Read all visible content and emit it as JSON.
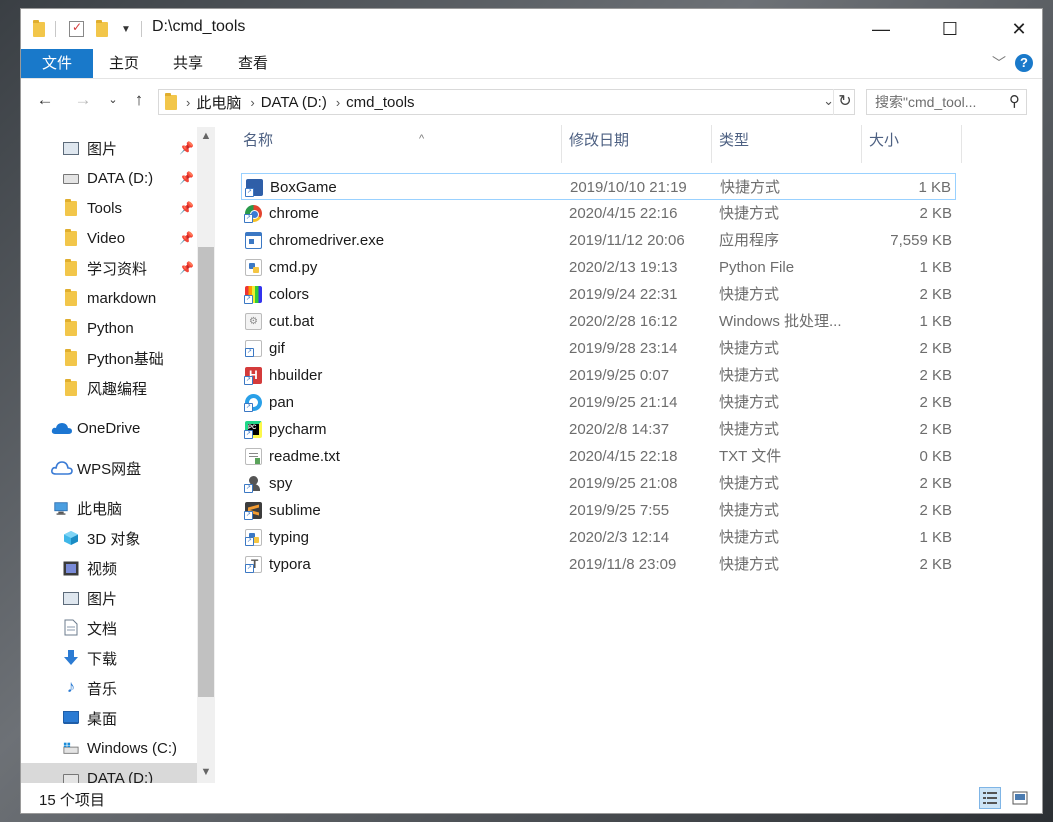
{
  "window": {
    "title": "D:\\cmd_tools",
    "controls": {
      "minimize": "—",
      "maximize": "☐",
      "close": "✕"
    }
  },
  "ribbon": {
    "tabs": [
      {
        "label": "文件"
      },
      {
        "label": "主页"
      },
      {
        "label": "共享"
      },
      {
        "label": "查看"
      }
    ],
    "help": "?"
  },
  "nav": {
    "path": [
      "此电脑",
      "DATA (D:)",
      "cmd_tools"
    ],
    "search_placeholder": "搜索\"cmd_tool..."
  },
  "sidebar": {
    "items": [
      {
        "label": "图片",
        "icon": "pictures-icon",
        "pinned": true
      },
      {
        "label": "DATA (D:)",
        "icon": "drive-icon",
        "pinned": true
      },
      {
        "label": "Tools",
        "icon": "folder-icon",
        "pinned": true
      },
      {
        "label": "Video",
        "icon": "folder-icon",
        "pinned": true
      },
      {
        "label": "学习资料",
        "icon": "folder-icon",
        "pinned": true
      },
      {
        "label": "markdown",
        "icon": "folder-icon",
        "pinned": false
      },
      {
        "label": "Python",
        "icon": "folder-icon",
        "pinned": false
      },
      {
        "label": "Python基础",
        "icon": "folder-icon",
        "pinned": false
      },
      {
        "label": "风趣编程",
        "icon": "folder-icon",
        "pinned": false
      },
      {
        "label": "OneDrive",
        "icon": "cloud-icon",
        "pinned": false
      },
      {
        "label": "WPS网盘",
        "icon": "wps-cloud-icon",
        "pinned": false
      },
      {
        "label": "此电脑",
        "icon": "computer-icon",
        "pinned": false
      },
      {
        "label": "3D 对象",
        "icon": "3d-objects-icon",
        "pinned": false
      },
      {
        "label": "视频",
        "icon": "videos-icon",
        "pinned": false
      },
      {
        "label": "图片",
        "icon": "pictures-icon",
        "pinned": false
      },
      {
        "label": "文档",
        "icon": "documents-icon",
        "pinned": false
      },
      {
        "label": "下载",
        "icon": "download-icon",
        "pinned": false
      },
      {
        "label": "音乐",
        "icon": "music-icon",
        "pinned": false
      },
      {
        "label": "桌面",
        "icon": "desktop-icon",
        "pinned": false
      },
      {
        "label": "Windows (C:)",
        "icon": "windows-drive-icon",
        "pinned": false
      },
      {
        "label": "DATA (D:)",
        "icon": "drive-icon",
        "pinned": false,
        "selected": true
      }
    ]
  },
  "columns": {
    "name": "名称",
    "date": "修改日期",
    "type": "类型",
    "size": "大小"
  },
  "files": [
    {
      "name": "BoxGame",
      "date": "2019/10/10 21:19",
      "type": "快捷方式",
      "size": "1 KB",
      "icon": "boxgame-icon",
      "color": "#2f5fa8",
      "selected": true
    },
    {
      "name": "chrome",
      "date": "2020/4/15 22:16",
      "type": "快捷方式",
      "size": "2 KB",
      "icon": "chrome-icon",
      "color": "#e3432f"
    },
    {
      "name": "chromedriver.exe",
      "date": "2019/11/12 20:06",
      "type": "应用程序",
      "size": "7,559 KB",
      "icon": "exe-icon",
      "color": "#3b78c4"
    },
    {
      "name": "cmd.py",
      "date": "2020/2/13 19:13",
      "type": "Python File",
      "size": "1 KB",
      "icon": "python-file-icon",
      "color": "#f4c542"
    },
    {
      "name": "colors",
      "date": "2019/9/24 22:31",
      "type": "快捷方式",
      "size": "2 KB",
      "icon": "colors-icon",
      "color": "#c23bd4"
    },
    {
      "name": "cut.bat",
      "date": "2020/2/28 16:12",
      "type": "Windows 批处理...",
      "size": "1 KB",
      "icon": "bat-file-icon",
      "color": "#9a9a9a"
    },
    {
      "name": "gif",
      "date": "2019/9/28 23:14",
      "type": "快捷方式",
      "size": "2 KB",
      "icon": "gif-icon",
      "color": "#8a8a8a"
    },
    {
      "name": "hbuilder",
      "date": "2019/9/25 0:07",
      "type": "快捷方式",
      "size": "2 KB",
      "icon": "hbuilder-icon",
      "color": "#d43b3b"
    },
    {
      "name": "pan",
      "date": "2019/9/25 21:14",
      "type": "快捷方式",
      "size": "2 KB",
      "icon": "pan-icon",
      "color": "#2aa0e8"
    },
    {
      "name": "pycharm",
      "date": "2020/2/8 14:37",
      "type": "快捷方式",
      "size": "2 KB",
      "icon": "pycharm-icon",
      "color": "#21d789"
    },
    {
      "name": "readme.txt",
      "date": "2020/4/15 22:18",
      "type": "TXT 文件",
      "size": "0 KB",
      "icon": "txt-file-icon",
      "color": "#5aa35a"
    },
    {
      "name": "spy",
      "date": "2019/9/25 21:08",
      "type": "快捷方式",
      "size": "2 KB",
      "icon": "spy-icon",
      "color": "#555555"
    },
    {
      "name": "sublime",
      "date": "2019/9/25 7:55",
      "type": "快捷方式",
      "size": "2 KB",
      "icon": "sublime-icon",
      "color": "#f39c33"
    },
    {
      "name": "typing",
      "date": "2020/2/3 12:14",
      "type": "快捷方式",
      "size": "1 KB",
      "icon": "typing-icon",
      "color": "#3b78c4"
    },
    {
      "name": "typora",
      "date": "2019/11/8 23:09",
      "type": "快捷方式",
      "size": "2 KB",
      "icon": "typora-icon",
      "color": "#888888"
    }
  ],
  "status": {
    "item_count": "15 个项目"
  },
  "colors": {
    "accent": "#1979ca",
    "selection_border": "#99d1ff",
    "header_text": "#4d6082",
    "muted_text": "#6d6d6d"
  }
}
